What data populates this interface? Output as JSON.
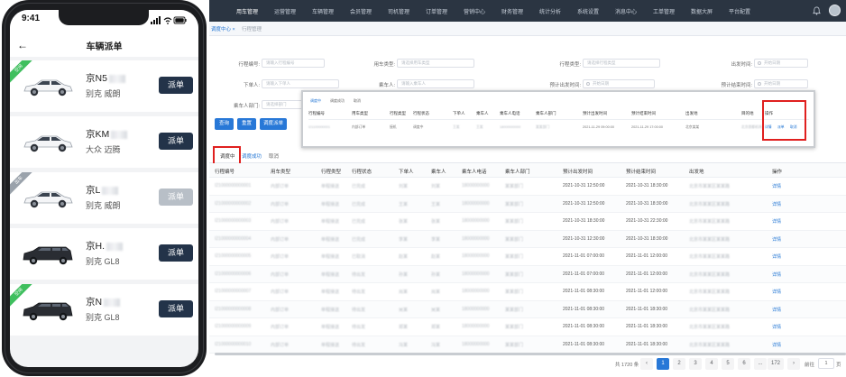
{
  "desktop": {
    "topnav": {
      "items": [
        "用车管理",
        "运营管理",
        "车辆管理",
        "会员管理",
        "司机管理",
        "订单管理",
        "营销中心",
        "财务管理",
        "统计分析",
        "系统设置",
        "消息中心",
        "工单管理",
        "数据大屏",
        "平台配置"
      ]
    },
    "subnav": {
      "active": "调度中心 ×",
      "other": "行程管理"
    },
    "filters": [
      {
        "label": "行程编号:",
        "placeholder": "请输入行程编号"
      },
      {
        "label": "用车类型:",
        "placeholder": "请选择用车类型"
      },
      {
        "label": "行程类型:",
        "placeholder": "请选择行程类型"
      },
      {
        "label": "出发时间:",
        "placeholder": "开始日期"
      },
      {
        "label": "下单人:",
        "placeholder": "请输入下单人"
      },
      {
        "label": "乘车人:",
        "placeholder": "请输入乘车人"
      },
      {
        "label": "预计出发时间:",
        "placeholder": "开始日期"
      },
      {
        "label": "预计结束时间:",
        "placeholder": "开始日期"
      },
      {
        "label": "乘车人部门:",
        "placeholder": "请选择部门"
      }
    ],
    "buttons": {
      "query": "查询",
      "reset": "重置",
      "dispatch": "调度派单"
    },
    "tabs": [
      "调度中",
      "调度成功",
      "取消"
    ],
    "columns": [
      "行程编号",
      "用车类型",
      "行程类型",
      "行程状态",
      "下单人",
      "乘车人",
      "乘车人电话",
      "乘车人部门",
      "预计出发时间",
      "预计结束时间",
      "出发地",
      "操作"
    ],
    "rows": [
      {
        "id": "I21000000000001",
        "use_type": "内部订单",
        "trip_type": "单程接送",
        "status": "已完成",
        "orderer": "刘某",
        "rider": "刘某",
        "phone": "18000000000",
        "dept": "某某部门",
        "start": "2021-10-31 12:50:00",
        "end": "2021-10-31 18:30:00",
        "origin": "北京市某某区某某路",
        "op": "详情"
      },
      {
        "id": "I21000000000002",
        "use_type": "内部订单",
        "trip_type": "单程接送",
        "status": "已完成",
        "orderer": "王某",
        "rider": "王某",
        "phone": "18000000000",
        "dept": "某某部门",
        "start": "2021-10-31 12:50:00",
        "end": "2021-10-31 18:30:00",
        "origin": "北京市某某区某某路",
        "op": "详情"
      },
      {
        "id": "I21000000000003",
        "use_type": "内部订单",
        "trip_type": "单程接送",
        "status": "已完成",
        "orderer": "张某",
        "rider": "张某",
        "phone": "18000000000",
        "dept": "某某部门",
        "start": "2021-10-31 18:30:00",
        "end": "2021-10-31 22:30:00",
        "origin": "北京市某某区某某路",
        "op": "详情"
      },
      {
        "id": "I21000000000004",
        "use_type": "内部订单",
        "trip_type": "单程接送",
        "status": "已完成",
        "orderer": "李某",
        "rider": "李某",
        "phone": "18000000000",
        "dept": "某某部门",
        "start": "2021-10-31 12:30:00",
        "end": "2021-10-31 18:30:00",
        "origin": "北京市某某区某某路",
        "op": "详情"
      },
      {
        "id": "I21000000000005",
        "use_type": "内部订单",
        "trip_type": "单程接送",
        "status": "已取消",
        "orderer": "赵某",
        "rider": "赵某",
        "phone": "18000000000",
        "dept": "某某部门",
        "start": "2021-11-01 07:00:00",
        "end": "2021-11-01 12:00:00",
        "origin": "北京市某某区某某路",
        "op": "详情"
      },
      {
        "id": "I21000000000006",
        "use_type": "内部订单",
        "trip_type": "单程接送",
        "status": "待出发",
        "orderer": "孙某",
        "rider": "孙某",
        "phone": "18000000000",
        "dept": "某某部门",
        "start": "2021-11-01 07:00:00",
        "end": "2021-11-01 12:00:00",
        "origin": "北京市某某区某某路",
        "op": "详情"
      },
      {
        "id": "I21000000000007",
        "use_type": "内部订单",
        "trip_type": "单程接送",
        "status": "待出发",
        "orderer": "周某",
        "rider": "周某",
        "phone": "18000000000",
        "dept": "某某部门",
        "start": "2021-11-01 08:30:00",
        "end": "2021-11-01 12:00:00",
        "origin": "北京市某某区某某路",
        "op": "详情"
      },
      {
        "id": "I21000000000008",
        "use_type": "内部订单",
        "trip_type": "单程接送",
        "status": "待出发",
        "orderer": "吴某",
        "rider": "吴某",
        "phone": "18000000000",
        "dept": "某某部门",
        "start": "2021-11-01 08:30:00",
        "end": "2021-11-01 18:30:00",
        "origin": "北京市某某区某某路",
        "op": "详情"
      },
      {
        "id": "I21000000000009",
        "use_type": "内部订单",
        "trip_type": "单程接送",
        "status": "待出发",
        "orderer": "郑某",
        "rider": "郑某",
        "phone": "18000000000",
        "dept": "某某部门",
        "start": "2021-11-01 08:30:00",
        "end": "2021-11-01 18:30:00",
        "origin": "北京市某某区某某路",
        "op": "详情"
      },
      {
        "id": "I21000000000010",
        "use_type": "内部订单",
        "trip_type": "单程接送",
        "status": "待出发",
        "orderer": "冯某",
        "rider": "冯某",
        "phone": "18000000000",
        "dept": "某某部门",
        "start": "2021-11-01 08:30:00",
        "end": "2021-11-01 18:30:00",
        "origin": "北京市某某区某某路",
        "op": "详情"
      }
    ],
    "pagination": {
      "total": "共 1720 条",
      "pages": [
        "1",
        "2",
        "3",
        "4",
        "5",
        "6",
        "...",
        "172"
      ],
      "goto": "前往",
      "goto_value": "1",
      "page": "页"
    },
    "zoom": {
      "tabs": [
        "调度中",
        "调度成功",
        "取消"
      ],
      "columns": [
        "行程编号",
        "用车类型",
        "行程类型",
        "行程状态",
        "下单人",
        "乘车人",
        "乘车人电话",
        "乘车人部门",
        "预计出发时间",
        "预计结束时间",
        "出发地",
        "目的地",
        "操作"
      ],
      "row": {
        "id": "I21100000001",
        "use_type": "内部订单",
        "trip_type": "接机",
        "status": "调度中",
        "orderer": "王某",
        "rider": "王某",
        "phone": "18000000000",
        "dept": "某某部门",
        "start": "2021-11-29 09:00:00",
        "end": "2021-11-29 17:00:00",
        "origin": "北京某某",
        "dest": "北京首都机场",
        "op1": "详情",
        "op2": "派单",
        "op3": "取消"
      }
    }
  },
  "phone": {
    "time": "9:41",
    "back": "←",
    "title": "车辆派单",
    "cards": [
      {
        "plate": "京N5",
        "model": "别克 威朗",
        "button": "派单",
        "badge": "空闲",
        "enabled": true
      },
      {
        "plate": "京KM",
        "model": "大众 迈腾",
        "button": "派单",
        "badge": "",
        "enabled": true
      },
      {
        "plate": "京L",
        "model": "别克 威朗",
        "button": "派单",
        "badge": "出车",
        "enabled": false
      },
      {
        "plate": "京H.",
        "model": "别克 GL8",
        "button": "派单",
        "badge": "",
        "enabled": true
      },
      {
        "plate": "京N",
        "model": "别克 GL8",
        "button": "派单",
        "badge": "空闲",
        "enabled": true
      }
    ]
  },
  "colors": {
    "accent": "#2878d7",
    "nav": "#2b3542",
    "highlight": "#e0201f",
    "dispatch": "#233349",
    "badge": "#3fbf5e"
  }
}
